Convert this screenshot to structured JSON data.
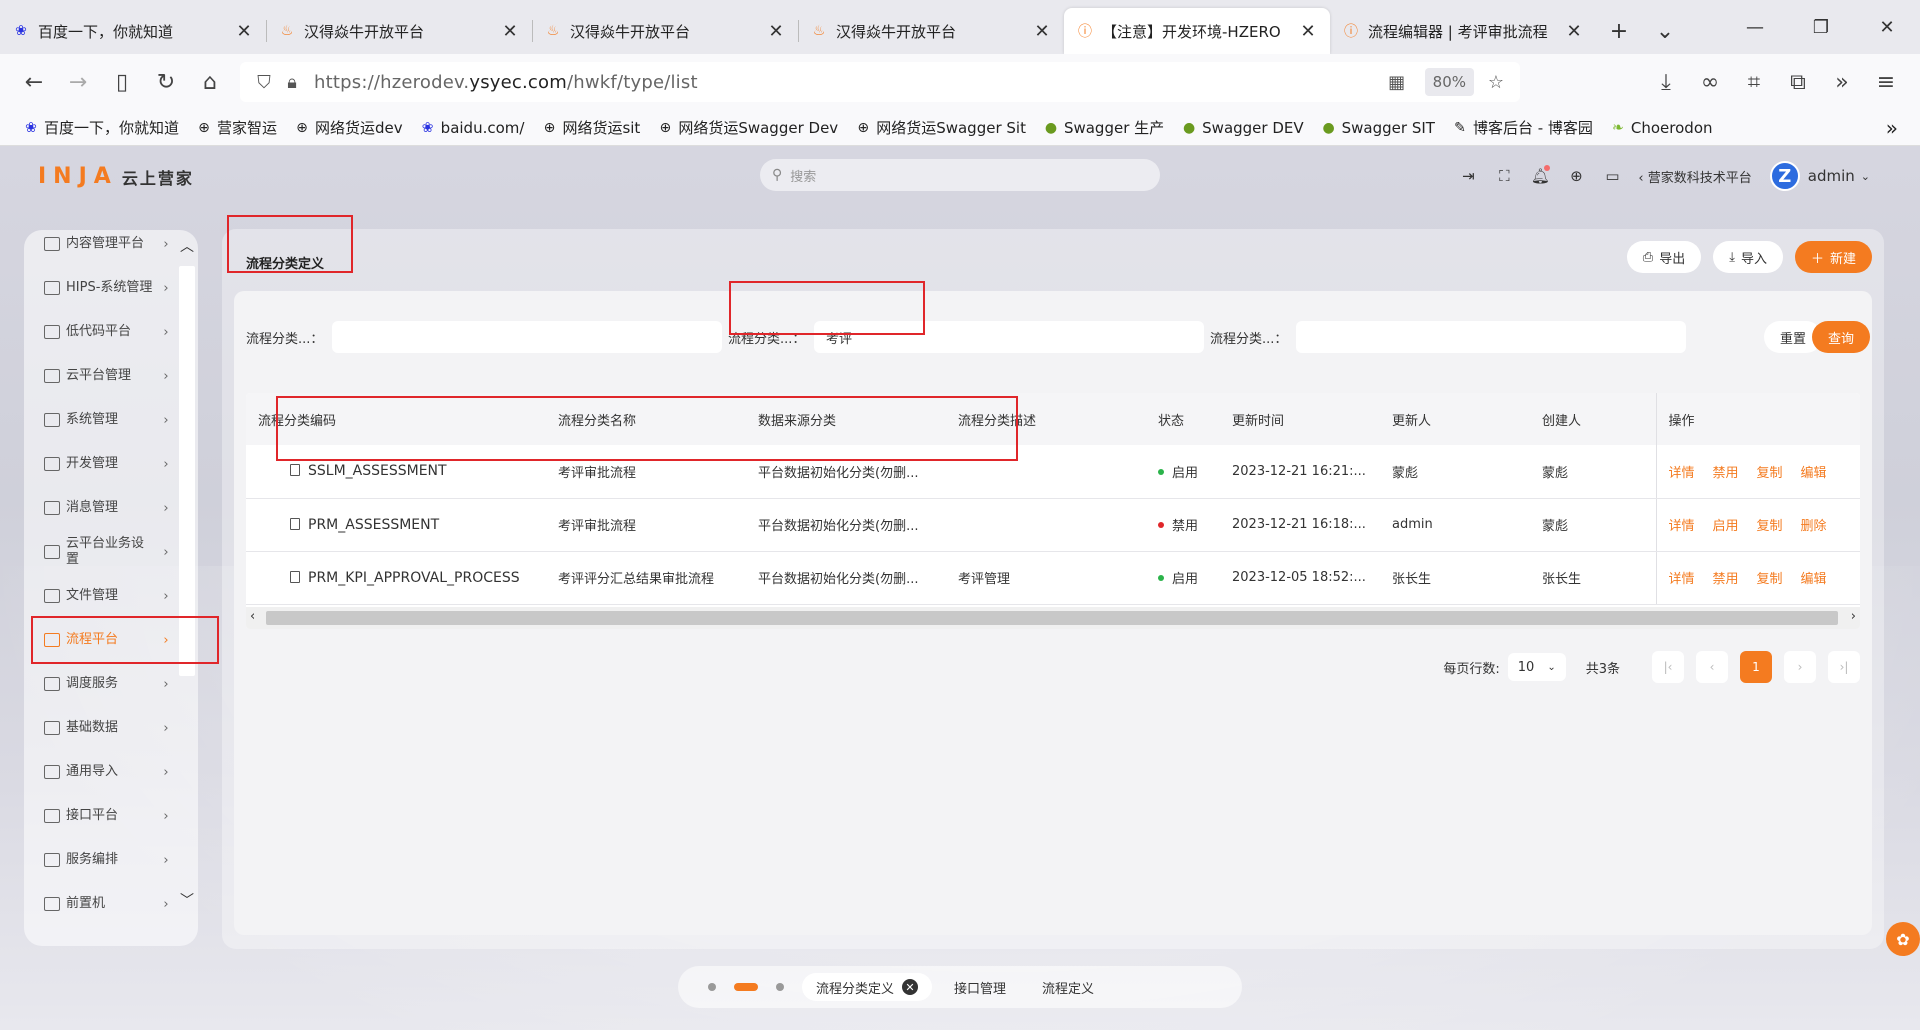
{
  "browser": {
    "tabs": [
      {
        "title": "百度一下，你就知道",
        "icon": "paw-icon"
      },
      {
        "title": "汉得焱牛开放平台",
        "icon": "flame-icon"
      },
      {
        "title": "汉得焱牛开放平台",
        "icon": "flame-icon"
      },
      {
        "title": "汉得焱牛开放平台",
        "icon": "flame-icon"
      },
      {
        "title": "【注意】开发环境-HZERO",
        "icon": "warning-icon"
      },
      {
        "title": "流程编辑器 | 考评审批流程",
        "icon": "warning-icon"
      }
    ],
    "active_tab_index": 4,
    "url_prefix": "https://hzerodev.",
    "url_domain": "ysyec.com",
    "url_path": "/hwkf/type/list",
    "zoom": "80%",
    "bookmarks": [
      {
        "label": "百度一下，你就知道",
        "icon": "paw-icon"
      },
      {
        "label": "营家智运",
        "icon": "globe-icon"
      },
      {
        "label": "网络货运dev",
        "icon": "globe-icon"
      },
      {
        "label": "baidu.com/",
        "icon": "paw-icon"
      },
      {
        "label": "网络货运sit",
        "icon": "globe-icon"
      },
      {
        "label": "网络货运Swagger Dev",
        "icon": "globe-icon"
      },
      {
        "label": "网络货运Swagger Sit",
        "icon": "globe-icon"
      },
      {
        "label": "Swagger 生产",
        "icon": "swagger-icon"
      },
      {
        "label": "Swagger DEV",
        "icon": "swagger-icon"
      },
      {
        "label": "Swagger SIT",
        "icon": "swagger-icon"
      },
      {
        "label": "博客后台 - 博客园",
        "icon": "blog-icon"
      },
      {
        "label": "Choerodon",
        "icon": "leaf-icon"
      }
    ]
  },
  "app": {
    "logo_mark": "INJA",
    "logo_text": "云上营家",
    "search_placeholder": "搜索",
    "tenant": "营家数科技术平台",
    "tenant_prefix": "‹",
    "user": "admin",
    "avatar_letter": "Z"
  },
  "sidebar": {
    "items": [
      {
        "label": "内容管理平台"
      },
      {
        "label": "HIPS-系统管理"
      },
      {
        "label": "低代码平台"
      },
      {
        "label": "云平台管理"
      },
      {
        "label": "系统管理"
      },
      {
        "label": "开发管理"
      },
      {
        "label": "消息管理"
      },
      {
        "label": "云平台业务设置"
      },
      {
        "label": "文件管理"
      },
      {
        "label": "流程平台"
      },
      {
        "label": "调度服务"
      },
      {
        "label": "基础数据"
      },
      {
        "label": "通用导入"
      },
      {
        "label": "接口平台"
      },
      {
        "label": "服务编排"
      },
      {
        "label": "前置机"
      }
    ],
    "active_index": 9
  },
  "page": {
    "title": "流程分类定义",
    "export_label": "导出",
    "import_label": "导入",
    "new_label": "新建",
    "filters": [
      {
        "label": "流程分类...：",
        "value": ""
      },
      {
        "label": "流程分类...：",
        "value": "考评"
      },
      {
        "label": "流程分类...：",
        "value": ""
      }
    ],
    "reset_label": "重置",
    "query_label": "查询"
  },
  "table": {
    "columns": [
      "流程分类编码",
      "流程分类名称",
      "数据来源分类",
      "流程分类描述",
      "状态",
      "更新时间",
      "更新人",
      "创建人",
      "操作"
    ],
    "rows": [
      {
        "code": "SSLM_ASSESSMENT",
        "name": "考评审批流程",
        "source": "平台数据初始化分类(勿删...",
        "desc": "",
        "status": "启用",
        "status_color": "#2bb34a",
        "updated": "2023-12-21 16:21:...",
        "updater": "蒙彪",
        "creator": "蒙彪",
        "ops": [
          "详情",
          "禁用",
          "复制",
          "编辑"
        ]
      },
      {
        "code": "PRM_ASSESSMENT",
        "name": "考评审批流程",
        "source": "平台数据初始化分类(勿删...",
        "desc": "",
        "status": "禁用",
        "status_color": "#e0262a",
        "updated": "2023-12-21 16:18:...",
        "updater": "admin",
        "creator": "蒙彪",
        "ops": [
          "详情",
          "启用",
          "复制",
          "删除"
        ]
      },
      {
        "code": "PRM_KPI_APPROVAL_PROCESS",
        "name": "考评评分汇总结果审批流程",
        "source": "平台数据初始化分类(勿删...",
        "desc": "考评管理",
        "status": "启用",
        "status_color": "#2bb34a",
        "updated": "2023-12-05 18:52:...",
        "updater": "张长生",
        "creator": "张长生",
        "ops": [
          "详情",
          "禁用",
          "复制",
          "编辑"
        ]
      }
    ]
  },
  "pagination": {
    "page_size_label": "每页行数:",
    "page_size": "10",
    "total": "共3条",
    "current_page": "1"
  },
  "bottom_tabs": [
    {
      "label": "流程分类定义",
      "active": true
    },
    {
      "label": "接口管理",
      "active": false
    },
    {
      "label": "流程定义",
      "active": false
    }
  ],
  "colors": {
    "accent": "#f47b20",
    "annotation": "#e0262a"
  }
}
